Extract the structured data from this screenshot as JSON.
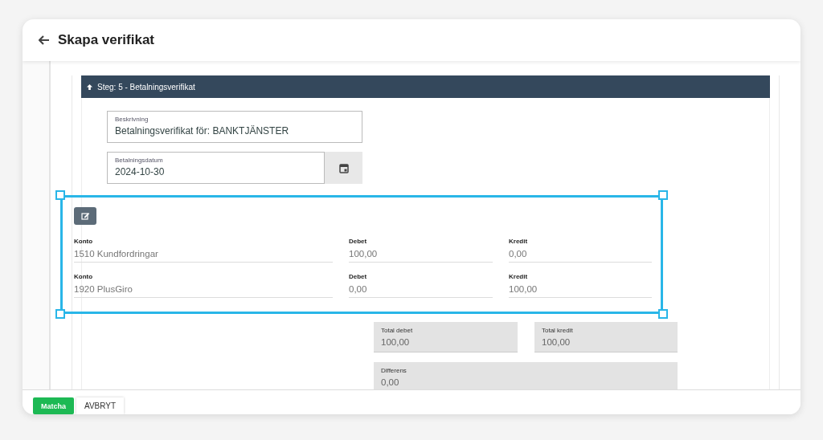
{
  "window": {
    "title": "Skapa verifikat"
  },
  "step": {
    "label": "Steg: 5 - Betalningsverifikat",
    "expanded": true
  },
  "description": {
    "label": "Beskrivning",
    "value": "Betalningsverifikat för: BANKTJÄNSTER"
  },
  "payment_date": {
    "label": "Betalningsdatum",
    "value": "2024-10-30"
  },
  "rows": [
    {
      "account_label": "Konto",
      "account": "1510 Kundfordringar",
      "debit_label": "Debet",
      "debit": "100,00",
      "credit_label": "Kredit",
      "credit": "0,00"
    },
    {
      "account_label": "Konto",
      "account": "1920 PlusGiro",
      "debit_label": "Debet",
      "debit": "0,00",
      "credit_label": "Kredit",
      "credit": "100,00"
    }
  ],
  "totals": [
    {
      "label": "Total debet",
      "value": "100,00"
    },
    {
      "label": "Total kredit",
      "value": "100,00"
    }
  ],
  "difference": {
    "label": "Differens",
    "value": "0,00"
  },
  "buttons": [
    {
      "label": "Matcha",
      "kind": "primary"
    },
    {
      "label": "AVBRYT",
      "kind": "plain"
    }
  ]
}
